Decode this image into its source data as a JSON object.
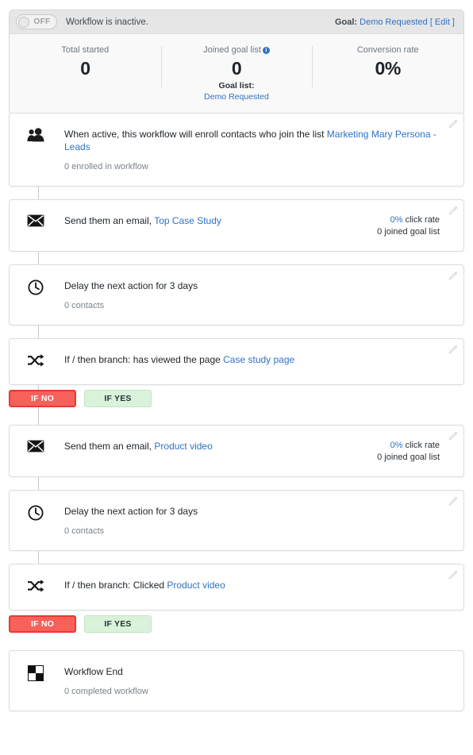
{
  "header": {
    "toggle": {
      "state_label": "OFF",
      "on": false
    },
    "status_text": "Workflow is inactive.",
    "goal_prefix": "Goal:",
    "goal_name": "Demo Requested",
    "goal_edit": "[ Edit ]"
  },
  "stats": [
    {
      "label": "Total started",
      "value": "0",
      "info_icon": false
    },
    {
      "label": "Joined goal list",
      "value": "0",
      "info_icon": true,
      "info_glyph": "i",
      "sub_label": "Goal list:",
      "sub_link": "Demo Requested"
    },
    {
      "label": "Conversion rate",
      "value": "0%",
      "info_icon": false
    }
  ],
  "steps": [
    {
      "icon": "people-icon",
      "title_prefix": "When active, this workflow will enroll contacts who join the list ",
      "title_link": "Marketing Mary Persona - Leads",
      "sub": "0 enrolled in workflow",
      "metrics": [],
      "branch": null,
      "edit_icon": "pencil-icon"
    },
    {
      "icon": "envelope-icon",
      "title_prefix": "Send them an email, ",
      "title_link": "Top Case Study",
      "sub": "",
      "metrics": [
        {
          "highlight": "0%",
          "text": " click rate"
        },
        {
          "highlight": "",
          "text": "0 joined goal list"
        }
      ],
      "branch": null,
      "edit_icon": "pencil-icon"
    },
    {
      "icon": "clock-icon",
      "title_prefix": "Delay the next action for 3 days",
      "title_link": "",
      "sub": "0 contacts",
      "metrics": [],
      "branch": null,
      "edit_icon": "pencil-icon"
    },
    {
      "icon": "shuffle-icon",
      "title_prefix": "If / then branch: has viewed the page ",
      "title_link": "Case study page",
      "sub": "",
      "metrics": [],
      "branch": {
        "no_label": "IF NO",
        "yes_label": "IF YES"
      },
      "edit_icon": "pencil-icon"
    },
    {
      "icon": "envelope-icon",
      "title_prefix": "Send them an email, ",
      "title_link": "Product video",
      "sub": "",
      "metrics": [
        {
          "highlight": "0%",
          "text": " click rate"
        },
        {
          "highlight": "",
          "text": "0 joined goal list"
        }
      ],
      "branch": null,
      "edit_icon": "pencil-icon"
    },
    {
      "icon": "clock-icon",
      "title_prefix": "Delay the next action for 3 days",
      "title_link": "",
      "sub": "0 contacts",
      "metrics": [],
      "branch": null,
      "edit_icon": "pencil-icon"
    },
    {
      "icon": "shuffle-icon",
      "title_prefix": "If / then branch: Clicked ",
      "title_link": "Product video",
      "sub": "",
      "metrics": [],
      "branch": {
        "no_label": "IF NO",
        "yes_label": "IF YES"
      },
      "edit_icon": "pencil-icon"
    },
    {
      "icon": "checkered-flag-icon",
      "title_prefix": "Workflow End",
      "title_link": "",
      "sub": "0 completed workflow",
      "metrics": [],
      "branch": null,
      "edit_icon": null
    }
  ],
  "colors": {
    "link": "#2f72c4",
    "no_fill": "#f8605a",
    "no_border": "#e83a32",
    "yes_fill": "#d9f2d9",
    "yes_border": "#bfe6c0",
    "header_bar": "#e6e6e6",
    "panel_bg": "#f9f9f9"
  }
}
